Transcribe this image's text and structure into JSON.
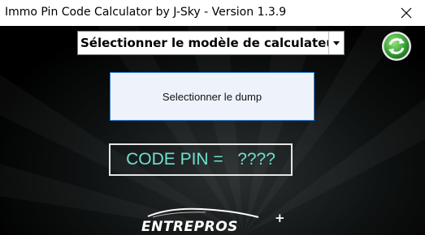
{
  "window": {
    "title": "Immo Pin Code Calculator by J-Sky  -  Version 1.3.9",
    "close_symbol": "✕"
  },
  "calculator_select": {
    "value": "Sélectionner le modèle de calculateur"
  },
  "dump_button": {
    "label": "Selectionner le dump"
  },
  "pin": {
    "label": "CODE PIN =   ????"
  },
  "logo": {
    "text": "ENTREPROS",
    "superscript": "+"
  },
  "colors": {
    "pin_text": "#6fe0cf",
    "refresh_green": "#3aa83a",
    "dump_border": "#2f84d9"
  },
  "icons": [
    "close-icon",
    "dropdown-arrow-icon",
    "refresh-icon",
    "car-logo-icon"
  ]
}
